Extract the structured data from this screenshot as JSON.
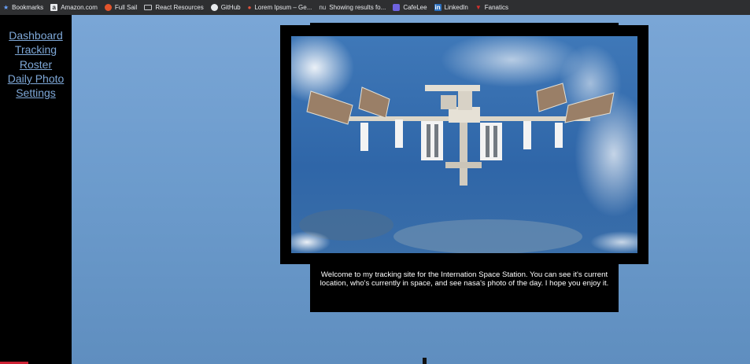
{
  "bookmarks": [
    {
      "label": "Bookmarks",
      "icon": "star-icon"
    },
    {
      "label": "Amazon.com",
      "icon": "amazon-icon"
    },
    {
      "label": "Full Sail",
      "icon": "fullsail-icon"
    },
    {
      "label": "React Resources",
      "icon": "folder-icon"
    },
    {
      "label": "GitHub",
      "icon": "github-icon"
    },
    {
      "label": "Lorem Ipsum – Ge...",
      "icon": "lorem-icon"
    },
    {
      "label": "Showing results fo...",
      "icon": "nu-icon"
    },
    {
      "label": "CafeLee",
      "icon": "cafelee-icon"
    },
    {
      "label": "LinkedIn",
      "icon": "linkedin-icon"
    },
    {
      "label": "Fanatics",
      "icon": "fanatics-icon"
    }
  ],
  "nav": {
    "items": [
      {
        "label": "Dashboard"
      },
      {
        "label": "Tracking"
      },
      {
        "label": "Roster"
      },
      {
        "label": "Daily Photo"
      },
      {
        "label": "Settings"
      }
    ]
  },
  "main": {
    "photo_subject": "International Space Station over Earth",
    "caption": "Welcome to my tracking site for the Internation Space Station. You can see it's current location, who's currently in space, and see nasa's photo of the day. I hope you enjoy it."
  },
  "colors": {
    "sidebar_bg": "#000000",
    "link": "#7ea8d8",
    "page_bg": "#6d9ccd",
    "bookmarks_bg": "#2e2f31"
  }
}
